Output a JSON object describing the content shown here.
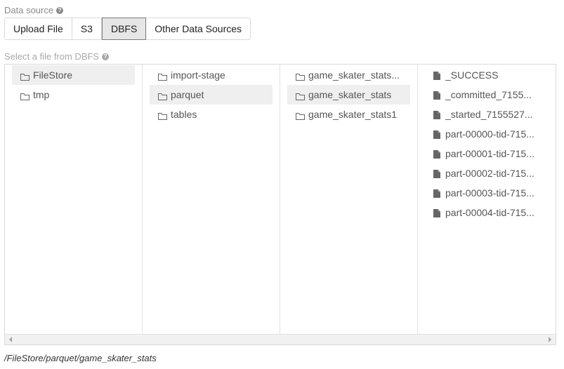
{
  "data_source": {
    "label": "Data source",
    "tabs": [
      {
        "label": "Upload File",
        "active": false
      },
      {
        "label": "S3",
        "active": false
      },
      {
        "label": "DBFS",
        "active": true
      },
      {
        "label": "Other Data Sources",
        "active": false
      }
    ]
  },
  "select_label": "Select a file from DBFS",
  "columns": [
    {
      "items": [
        {
          "type": "folder",
          "name": "FileStore",
          "selected": true
        },
        {
          "type": "folder",
          "name": "tmp",
          "selected": false
        }
      ]
    },
    {
      "items": [
        {
          "type": "folder",
          "name": "import-stage",
          "selected": false
        },
        {
          "type": "folder",
          "name": "parquet",
          "selected": true
        },
        {
          "type": "folder",
          "name": "tables",
          "selected": false
        }
      ]
    },
    {
      "items": [
        {
          "type": "folder",
          "name": "game_skater_stats...",
          "selected": false
        },
        {
          "type": "folder",
          "name": "game_skater_stats",
          "selected": true
        },
        {
          "type": "folder",
          "name": "game_skater_stats1",
          "selected": false
        }
      ]
    },
    {
      "items": [
        {
          "type": "file",
          "name": "_SUCCESS",
          "selected": false
        },
        {
          "type": "file",
          "name": "_committed_7155...",
          "selected": false
        },
        {
          "type": "file",
          "name": "_started_7155527...",
          "selected": false
        },
        {
          "type": "file",
          "name": "part-00000-tid-715...",
          "selected": false
        },
        {
          "type": "file",
          "name": "part-00001-tid-715...",
          "selected": false
        },
        {
          "type": "file",
          "name": "part-00002-tid-715...",
          "selected": false
        },
        {
          "type": "file",
          "name": "part-00003-tid-715...",
          "selected": false
        },
        {
          "type": "file",
          "name": "part-00004-tid-715...",
          "selected": false
        }
      ]
    }
  ],
  "selected_path": "/FileStore/parquet/game_skater_stats",
  "icons": {
    "help": "help-circle-icon",
    "folder": "folder-outline-icon",
    "file": "file-icon",
    "scroll_left": "scroll-left-arrow-icon",
    "scroll_right": "scroll-right-arrow-icon"
  },
  "colors": {
    "selected_row": "#efefef",
    "active_tab": "#e6e6e6",
    "label": "#8a8a8a"
  }
}
